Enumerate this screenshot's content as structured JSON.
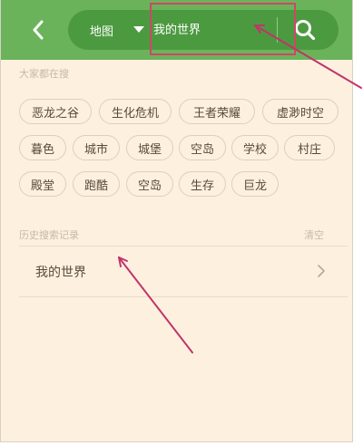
{
  "header": {
    "search_type": "地图",
    "search_query": "我的世界",
    "icons": {
      "back": "chevron-left-icon",
      "type_dropdown": "caret-down-icon",
      "search": "search-icon"
    }
  },
  "hot_searches": {
    "title": "大家都在搜",
    "tags": [
      "恶龙之谷",
      "生化危机",
      "王者荣耀",
      "虚渺时空",
      "暮色",
      "城市",
      "城堡",
      "空岛",
      "学校",
      "村庄",
      "殿堂",
      "跑酷",
      "空岛",
      "生存",
      "巨龙"
    ]
  },
  "history": {
    "title": "历史搜索记录",
    "clear_label": "清空",
    "items": [
      {
        "label": "我的世界"
      }
    ]
  },
  "colors": {
    "header_green": "#6bb35a",
    "search_green": "#4c9a40",
    "background": "#fdf0df",
    "annotation": "#d0456a"
  }
}
